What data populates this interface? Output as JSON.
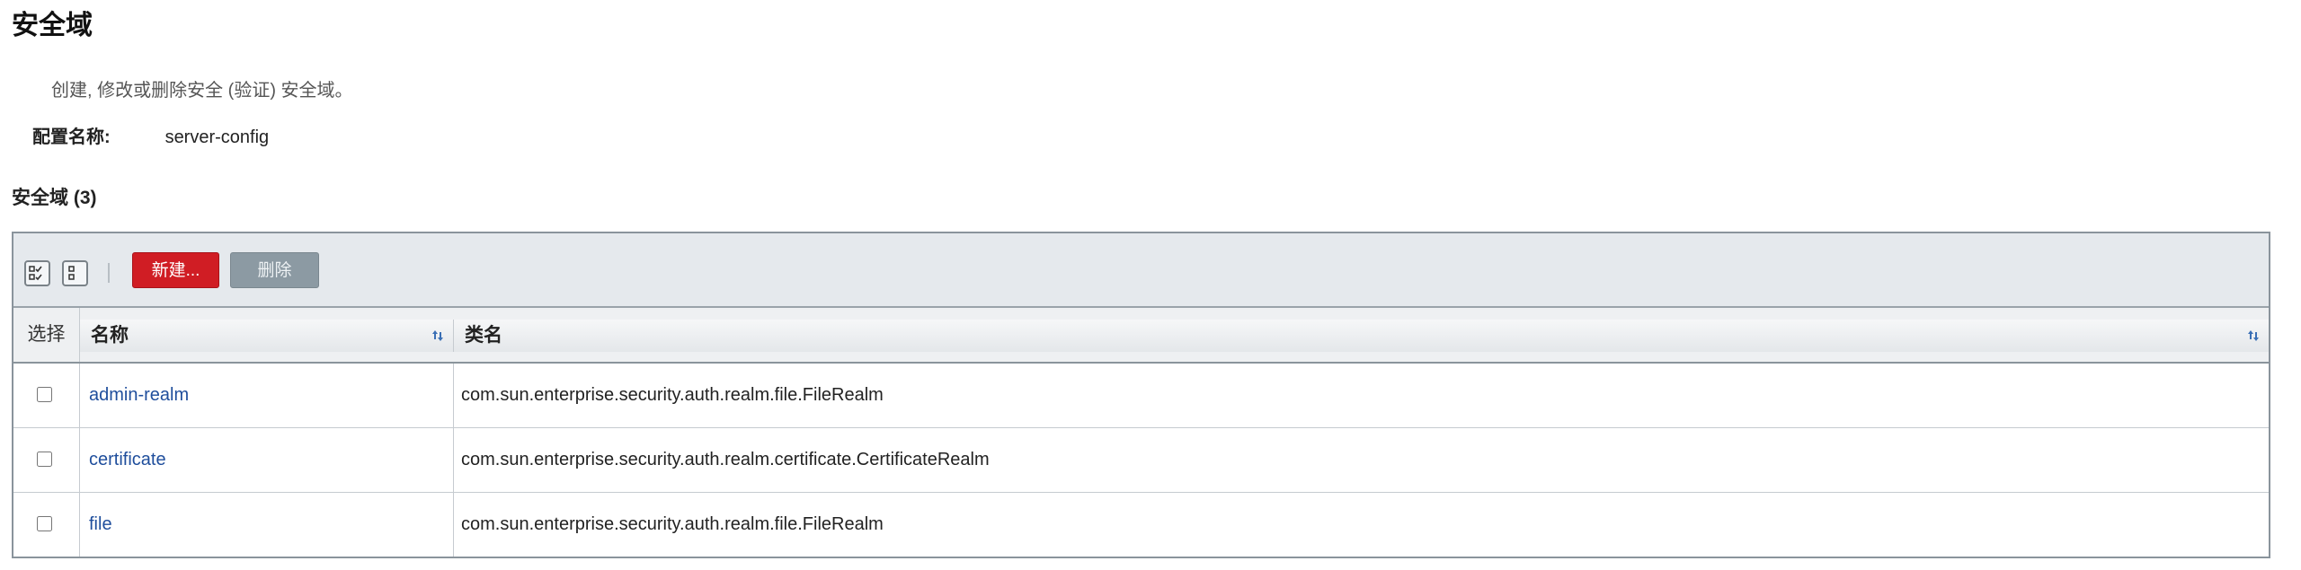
{
  "page": {
    "title": "安全域",
    "help": "创建, 修改或删除安全 (验证) 安全域。",
    "config_label": "配置名称:",
    "config_value": "server-config"
  },
  "table": {
    "title": "安全域 (3)",
    "toolbar": {
      "select_all_icon": "select-all-icon",
      "deselect_all_icon": "deselect-all-icon",
      "new_label": "新建...",
      "delete_label": "删除"
    },
    "columns": {
      "select": "选择",
      "name": "名称",
      "classname": "类名"
    },
    "rows": [
      {
        "name": "admin-realm",
        "classname": "com.sun.enterprise.security.auth.realm.file.FileRealm"
      },
      {
        "name": "certificate",
        "classname": "com.sun.enterprise.security.auth.realm.certificate.CertificateRealm"
      },
      {
        "name": "file",
        "classname": "com.sun.enterprise.security.auth.realm.file.FileRealm"
      }
    ]
  },
  "colors": {
    "new_button": "#d01d24",
    "delete_button": "#8c9aa3",
    "link": "#1f4e9c",
    "toolbar_bg": "#e5e9ed"
  }
}
